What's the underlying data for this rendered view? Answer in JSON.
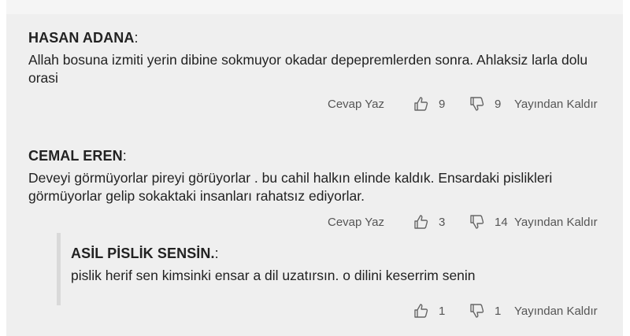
{
  "comments": [
    {
      "author": "HASAN ADANA",
      "text": "Allah bosuna izmiti yerin dibine sokmuyor okadar depepremlerden sonra. Ahlaksiz larla dolu orasi",
      "reply_label": "Cevap Yaz",
      "likes": "9",
      "dislikes": "9",
      "remove_label": "Yayından Kaldır"
    },
    {
      "author": "CEMAL EREN",
      "text": "Deveyi görmüyorlar pireyi görüyorlar . bu cahil halkın elinde kaldık. Ensardaki pislikleri görmüyorlar gelip sokaktaki insanları rahatsız ediyorlar.",
      "reply_label": "Cevap Yaz",
      "likes": "3",
      "dislikes": "14",
      "remove_label": "Yayından Kaldır",
      "replies": [
        {
          "author": "ASİL PİSLİK SENSİN.",
          "text": "pislik herif sen kimsinki ensar a dil uzatırsın. o dilini keserrim senin",
          "likes": "1",
          "dislikes": "1",
          "remove_label": "Yayından Kaldır"
        }
      ]
    }
  ],
  "icons": {
    "like": "thumbs-up-icon",
    "dislike": "thumbs-down-icon"
  }
}
